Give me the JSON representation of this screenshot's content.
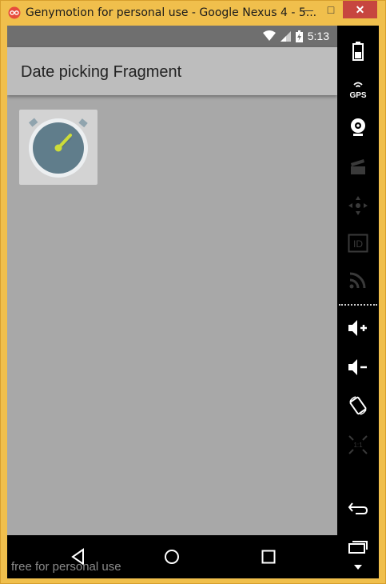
{
  "window": {
    "title": "Genymotion for personal use - Google Nexus 4 - 5...",
    "minimize": "—",
    "maximize": "□",
    "close": "✕"
  },
  "statusbar": {
    "time": "5:13"
  },
  "app": {
    "title": "Date picking Fragment"
  },
  "watermark": "free for personal use",
  "sidebar": {
    "gps_label": "GPS",
    "id_label": "ID",
    "scale_label": "1:1"
  },
  "colors": {
    "window_frame": "#f0bf4c",
    "close_button": "#c7463f",
    "screen_bg": "#a8a8a8",
    "appbar_bg": "#bdbdbd",
    "clock_face": "#607d8b",
    "clock_hand": "#cddc39"
  }
}
